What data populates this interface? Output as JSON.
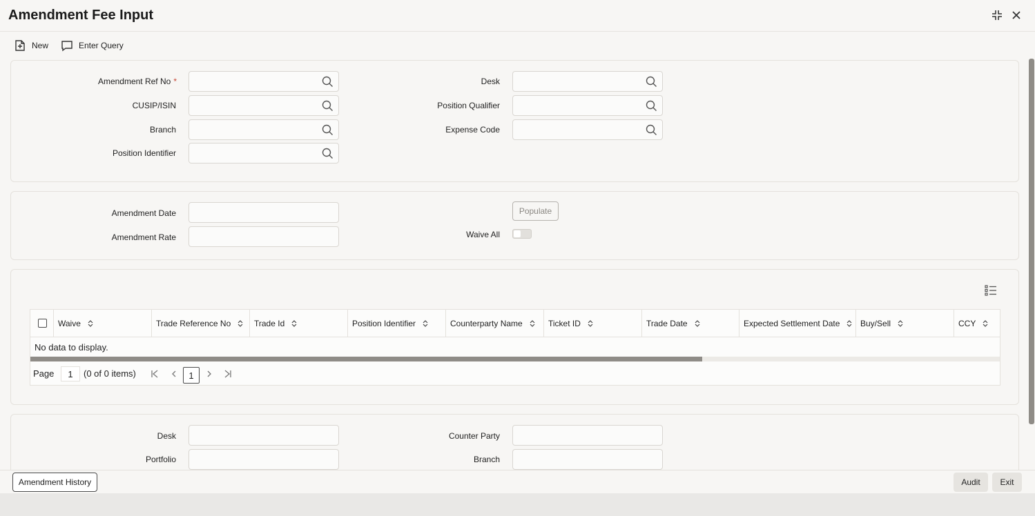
{
  "window": {
    "title": "Amendment Fee Input"
  },
  "toolbar": {
    "new_label": "New",
    "enter_query_label": "Enter Query"
  },
  "criteria": {
    "amendment_ref_no_label": "Amendment Ref No",
    "required_mark": "*",
    "cusip_isin_label": "CUSIP/ISIN",
    "branch_label": "Branch",
    "position_identifier_label": "Position Identifier",
    "desk_label": "Desk",
    "position_qualifier_label": "Position Qualifier",
    "expense_code_label": "Expense Code"
  },
  "amendment": {
    "date_label": "Amendment Date",
    "rate_label": "Amendment Rate",
    "populate_label": "Populate",
    "waive_all_label": "Waive All"
  },
  "grid": {
    "columns": [
      "Waive",
      "Trade Reference No",
      "Trade Id",
      "Position Identifier",
      "Counterparty Name",
      "Ticket ID",
      "Trade Date",
      "Expected Settlement Date",
      "Buy/Sell",
      "CCY"
    ],
    "empty_text": "No data to display.",
    "pager": {
      "page_label": "Page",
      "page_value": "1",
      "items_text": "(0 of 0 items)",
      "current_page": "1"
    }
  },
  "details": {
    "desk_label": "Desk",
    "portfolio_label": "Portfolio",
    "counter_party_label": "Counter Party",
    "branch_label": "Branch"
  },
  "footer": {
    "amendment_history_label": "Amendment History",
    "audit_label": "Audit",
    "exit_label": "Exit"
  }
}
